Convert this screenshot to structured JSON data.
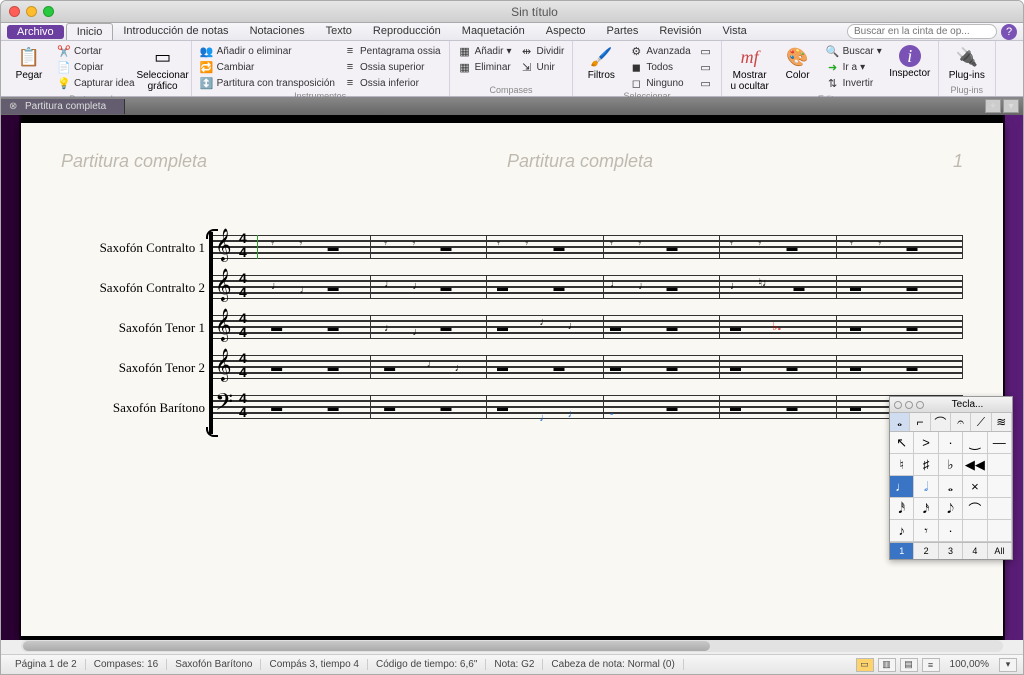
{
  "window": {
    "title": "Sin título"
  },
  "menubar": {
    "file": "Archivo",
    "tabs": [
      "Inicio",
      "Introducción de notas",
      "Notaciones",
      "Texto",
      "Reproducción",
      "Maquetación",
      "Aspecto",
      "Partes",
      "Revisión",
      "Vista"
    ],
    "active_tab": 0,
    "search_placeholder": "Buscar en la cinta de op..."
  },
  "ribbon": {
    "groups": {
      "portapapeles": {
        "label": "Portapapeles",
        "paste": "Pegar",
        "cut": "Cortar",
        "copy": "Copiar",
        "capture": "Capturar idea",
        "select_graphic": "Seleccionar gráfico"
      },
      "instrumentos": {
        "label": "Instrumentos",
        "add_remove": "Añadir o eliminar",
        "change": "Cambiar",
        "transposing": "Partitura con transposición",
        "ossia_staff": "Pentagrama ossia",
        "ossia_above": "Ossia superior",
        "ossia_below": "Ossia inferior"
      },
      "compases": {
        "label": "Compases",
        "add": "Añadir",
        "delete": "Eliminar",
        "split": "Dividir",
        "join": "Unir"
      },
      "seleccionar": {
        "label": "Seleccionar",
        "filters": "Filtros",
        "advanced": "Avanzada",
        "all": "Todos",
        "none": "Ninguno"
      },
      "editar": {
        "label": "Editar",
        "show_hide": "Mostrar u ocultar",
        "color": "Color",
        "find": "Buscar",
        "goto": "Ir a",
        "flip": "Invertir",
        "inspector": "Inspector"
      },
      "plugins": {
        "label": "Plug-ins",
        "plugins": "Plug-ins"
      }
    }
  },
  "doc_tab": {
    "name": "Partitura completa"
  },
  "page": {
    "header_left": "Partitura completa",
    "header_center": "Partitura completa",
    "page_number": "1"
  },
  "instruments": [
    "Saxofón Contralto 1",
    "Saxofón Contralto 2",
    "Saxofón Tenor 1",
    "Saxofón Tenor 2",
    "Saxofón Barítono"
  ],
  "clefs": [
    "𝄞",
    "𝄞",
    "𝄞",
    "𝄞",
    "𝄢"
  ],
  "timesig": {
    "num": "4",
    "den": "4"
  },
  "keypad": {
    "title": "Tecla...",
    "footer": [
      "1",
      "2",
      "3",
      "4",
      "All"
    ],
    "active_footer": 0
  },
  "statusbar": {
    "page": "Página 1 de 2",
    "bars": "Compases: 16",
    "instrument": "Saxofón Barítono",
    "position": "Compás 3, tiempo 4",
    "timecode": "Código de tiempo: 6,6\"",
    "note": "Nota: G2",
    "notehead": "Cabeza de nota: Normal (0)",
    "zoom": "100,00%"
  }
}
